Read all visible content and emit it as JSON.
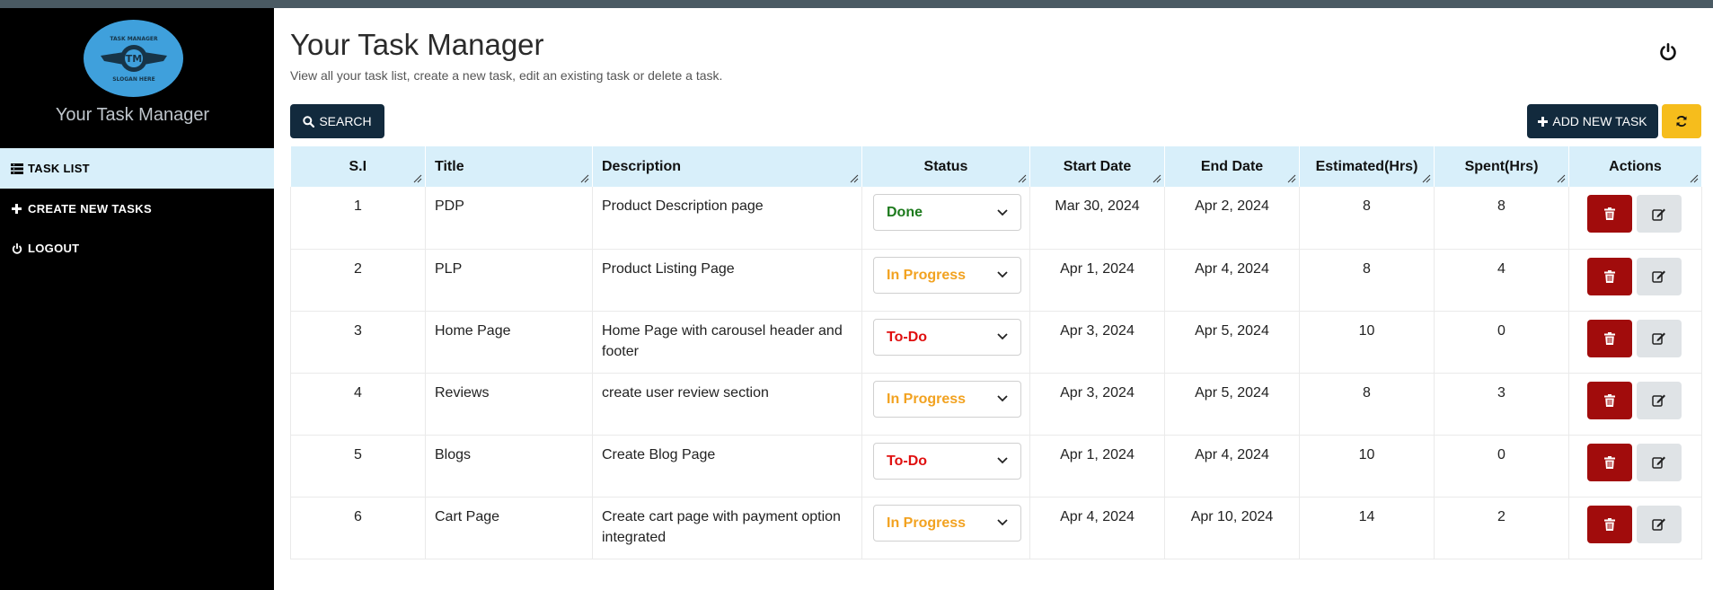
{
  "sidebar": {
    "logo_text": "TM",
    "logo_top_text": "TASK MANAGER",
    "logo_bottom_text": "SLOGAN HERE",
    "brand_name": "Your Task Manager",
    "items": [
      {
        "label": "TASK LIST",
        "icon": "list-icon",
        "active": true
      },
      {
        "label": "CREATE NEW TASKS",
        "icon": "plus-icon",
        "active": false
      },
      {
        "label": "LOGOUT",
        "icon": "power-icon",
        "active": false
      }
    ]
  },
  "header": {
    "title": "Your Task Manager",
    "subtitle": "View all your task list, create a new task, edit an existing task or delete a task."
  },
  "toolbar": {
    "search_label": "SEARCH",
    "add_label": "ADD NEW TASK",
    "refresh_icon": "refresh-icon"
  },
  "table": {
    "columns": [
      "S.I",
      "Title",
      "Description",
      "Status",
      "Start Date",
      "End Date",
      "Estimated(Hrs)",
      "Spent(Hrs)",
      "Actions"
    ],
    "rows": [
      {
        "si": "1",
        "title": "PDP",
        "description": "Product Description page",
        "status": "Done",
        "start": "Mar 30, 2024",
        "end": "Apr 2, 2024",
        "estimated": "8",
        "spent": "8"
      },
      {
        "si": "2",
        "title": "PLP",
        "description": "Product Listing Page",
        "status": "In Progress",
        "start": "Apr 1, 2024",
        "end": "Apr 4, 2024",
        "estimated": "8",
        "spent": "4"
      },
      {
        "si": "3",
        "title": "Home Page",
        "description": "Home Page with carousel header and footer",
        "status": "To-Do",
        "start": "Apr 3, 2024",
        "end": "Apr 5, 2024",
        "estimated": "10",
        "spent": "0"
      },
      {
        "si": "4",
        "title": "Reviews",
        "description": "create user review section",
        "status": "In Progress",
        "start": "Apr 3, 2024",
        "end": "Apr 5, 2024",
        "estimated": "8",
        "spent": "3"
      },
      {
        "si": "5",
        "title": "Blogs",
        "description": "Create Blog Page",
        "status": "To-Do",
        "start": "Apr 1, 2024",
        "end": "Apr 4, 2024",
        "estimated": "10",
        "spent": "0"
      },
      {
        "si": "6",
        "title": "Cart Page",
        "description": "Create cart page with payment option integrated",
        "status": "In Progress",
        "start": "Apr 4, 2024",
        "end": "Apr 10, 2024",
        "estimated": "14",
        "spent": "2"
      }
    ]
  },
  "colors": {
    "sidebar_bg": "#000000",
    "active_nav_bg": "#d8effa",
    "dark_button": "#122a3d",
    "refresh_button": "#f6bd1c",
    "delete_button": "#a10c0c",
    "edit_button": "#dfe3e6",
    "status_done": "#1d7a1d",
    "status_in_progress": "#f2a220",
    "status_todo": "#e01010"
  }
}
